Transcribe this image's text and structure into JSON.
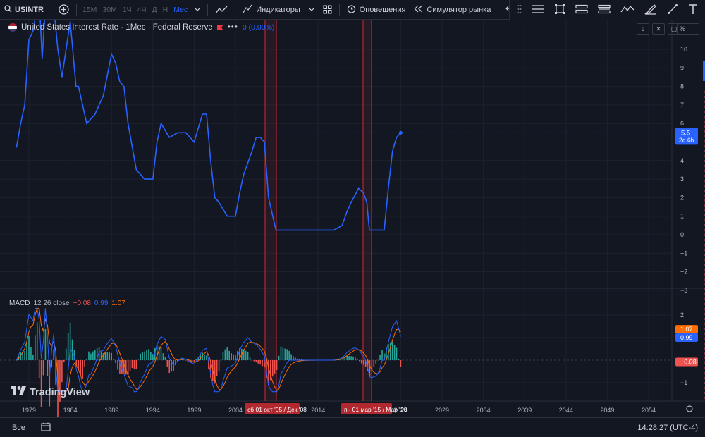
{
  "toolbar": {
    "symbol": "USINTR",
    "timeframes": [
      "15М",
      "30М",
      "1Ч",
      "4Ч",
      "Д",
      "Н",
      "Мес"
    ],
    "active_timeframe": "Мес",
    "indicators_label": "Индикаторы",
    "alerts_label": "Оповещения",
    "replay_label": "Симулятор рынка"
  },
  "legend": {
    "title": "United States Interest Rate · 1Мес · Federal Reserve",
    "change": "0 (0.00%)"
  },
  "macd_legend": {
    "name": "MACD",
    "params": "12 26 close",
    "hist": "−0.08",
    "macd": "0.99",
    "signal": "1.07"
  },
  "scale": {
    "mode_label": "%",
    "price_ticks": [
      "10",
      "9",
      "8",
      "7",
      "6",
      "5",
      "4",
      "3",
      "2",
      "1",
      "0",
      "−1",
      "−2",
      "−3"
    ],
    "macd_ticks": [
      "2",
      "1",
      "−1"
    ],
    "last_price": "5.5",
    "countdown": "2d 6h",
    "macd_signal_label": "1.07",
    "macd_line_label": "0.99",
    "macd_hist_label": "−0.08"
  },
  "time_axis": {
    "labels": [
      "1979",
      "1984",
      "1989",
      "1994",
      "1999",
      "2004",
      "2014",
      "2024",
      "2029",
      "2034",
      "2039",
      "2044",
      "2049",
      "2054"
    ],
    "highlight_1": "сб 01 окт '05 / Дек '08",
    "highlight_2": "пн 01 мар '15 / Мар '20"
  },
  "chart_data": [
    {
      "type": "line",
      "title": "United States Interest Rate · 1Мес · Federal Reserve",
      "x": [
        1977.5,
        1978,
        1978.5,
        1979,
        1979.5,
        1980,
        1980.3,
        1980.6,
        1981,
        1981.5,
        1982,
        1982.5,
        1983,
        1984,
        1984.7,
        1985,
        1986,
        1987,
        1987.5,
        1988,
        1989,
        1989.5,
        1990,
        1990.5,
        1991,
        1992,
        1993,
        1994,
        1994.5,
        1995,
        1996,
        1997,
        1998,
        1999,
        2000,
        2000.5,
        2001,
        2001.5,
        2002,
        2003,
        2004,
        2004.5,
        2005,
        2006,
        2006.5,
        2007,
        2007.5,
        2008,
        2008.9,
        2015.9,
        2016.9,
        2017.5,
        2018,
        2018.9,
        2019.5,
        2019.9,
        2020.2,
        2022,
        2022.5,
        2023,
        2023.5,
        2024
      ],
      "y": [
        4.7,
        6.0,
        7.0,
        10.5,
        11.0,
        18.0,
        13.0,
        9.5,
        19.0,
        16.0,
        14.0,
        10.0,
        8.5,
        11.5,
        8.0,
        8.0,
        6.0,
        6.5,
        7.0,
        7.5,
        9.75,
        9.25,
        8.25,
        8.0,
        6.0,
        3.5,
        3.0,
        3.0,
        5.0,
        6.0,
        5.25,
        5.5,
        5.5,
        5.0,
        6.5,
        6.5,
        4.0,
        2.0,
        1.75,
        1.0,
        1.0,
        2.25,
        3.25,
        4.5,
        5.25,
        5.25,
        5.0,
        2.0,
        0.25,
        0.25,
        0.5,
        1.25,
        1.75,
        2.5,
        2.25,
        1.75,
        0.25,
        0.25,
        2.5,
        4.5,
        5.25,
        5.5
      ],
      "ylim": [
        -3,
        11
      ]
    },
    {
      "type": "line",
      "title": "MACD 12 26 close",
      "series": [
        {
          "name": "MACD",
          "values": [
            0.99
          ]
        },
        {
          "name": "Signal",
          "values": [
            1.07
          ]
        },
        {
          "name": "Histogram",
          "values": [
            -0.08
          ]
        }
      ],
      "ylim": [
        -1.5,
        2.5
      ]
    }
  ],
  "bottombar": {
    "range_label": "Все",
    "clock": "14:28:27 (UTC-4)"
  },
  "brand": {
    "logo_text": "TradingView"
  },
  "colors": {
    "background": "#131722",
    "line": "#2962ff",
    "macd": "#2962ff",
    "signal": "#ff6d00",
    "hist_up": "#26a69a",
    "hist_down": "#ef5350",
    "highlight": "#f23645"
  }
}
